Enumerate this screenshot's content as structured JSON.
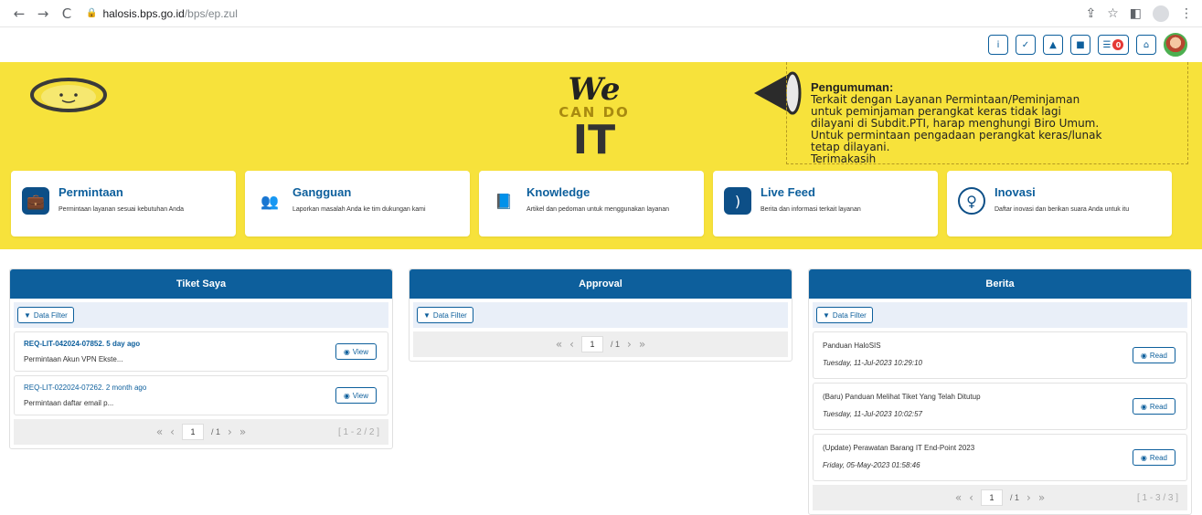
{
  "browser": {
    "back": "←",
    "forward": "→",
    "reload": "C",
    "url_host": "halosis.bps.go.id",
    "url_path": "/bps/ep.zul"
  },
  "header": {
    "info": "i",
    "check": "✓",
    "warn": "▲",
    "book": "■",
    "inbox_badge": "0",
    "home": "⌂"
  },
  "banner": {
    "we": "We",
    "cando": "CAN DO",
    "it": "IT",
    "announce_title": "Pengumuman:",
    "announce_body": "Terkait dengan Layanan Permintaan/Peminjaman\nuntuk peminjaman perangkat keras tidak lagi\ndilayani di Subdit.PTI, harap menghungi Biro Umum.\nUntuk permintaan pengadaan perangkat keras/lunak\ntetap dilayani.\nTerimakasih"
  },
  "cards": [
    {
      "title": "Permintaan",
      "desc": "Permintaan layanan sesuai kebutuhan Anda"
    },
    {
      "title": "Gangguan",
      "desc": "Laporkan masalah Anda ke tim dukungan kami"
    },
    {
      "title": "Knowledge",
      "desc": "Artikel dan pedoman untuk menggunakan layanan"
    },
    {
      "title": "Live Feed",
      "desc": "Berita dan informasi terkait layanan"
    },
    {
      "title": "Inovasi",
      "desc": "Daftar inovasi dan berikan suara Anda untuk itu"
    }
  ],
  "tiket": {
    "title": "Tiket Saya",
    "filter": "Data Filter",
    "items": [
      {
        "ref": "REQ-LIT-042024-07852. 5 day ago",
        "desc": "Permintaan Akun VPN Ekste...",
        "action": "View"
      },
      {
        "ref": "REQ-LIT-022024-07262. 2 month ago",
        "desc": "Permintaan daftar email p...",
        "action": "View"
      }
    ],
    "page": "1",
    "of": "/ 1",
    "range": "[ 1 - 2 / 2 ]"
  },
  "approval": {
    "title": "Approval",
    "filter": "Data Filter",
    "page": "1",
    "of": "/ 1"
  },
  "berita": {
    "title": "Berita",
    "filter": "Data Filter",
    "items": [
      {
        "title": "Panduan HaloSIS",
        "date": "Tuesday, 11-Jul-2023 10:29:10",
        "action": "Read"
      },
      {
        "title": "(Baru) Panduan Melihat Tiket Yang Telah Ditutup",
        "date": "Tuesday, 11-Jul-2023 10:02:57",
        "action": "Read"
      },
      {
        "title": "(Update) Perawatan Barang IT End-Point 2023",
        "date": "Friday, 05-May-2023 01:58:46",
        "action": "Read"
      }
    ],
    "page": "1",
    "of": "/ 1",
    "range": "[ 1 - 3 / 3 ]"
  }
}
